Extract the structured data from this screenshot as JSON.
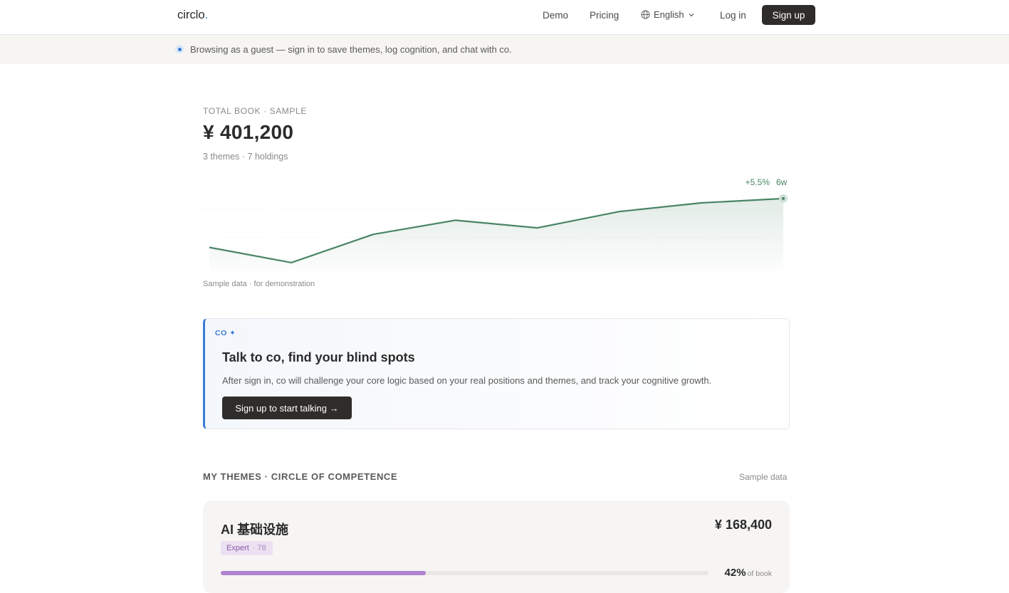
{
  "nav": {
    "logo": "circlo",
    "logo_dot": ".",
    "links": [
      "Demo",
      "Pricing"
    ],
    "language": "English",
    "login": "Log in",
    "signup": "Sign up"
  },
  "banner": {
    "text": "Browsing as a guest — sign in to save themes, log cognition, and chat with co."
  },
  "summary": {
    "label": "TOTAL BOOK · SAMPLE",
    "value": "¥ 401,200",
    "sub": "3 themes · 7 holdings",
    "note": "Sample data · for demonstration"
  },
  "chart_data": {
    "type": "area",
    "values": [
      100.0,
      98.6,
      101.2,
      102.5,
      101.8,
      103.3,
      104.1,
      104.5
    ],
    "ylim": [
      98,
      106
    ],
    "change_label": "+5.5%",
    "end_label": "6w",
    "line_color": "#4a8566",
    "grid": false
  },
  "co_card": {
    "tag": "CO ✦",
    "title": "Talk to co, find your blind spots",
    "description": "After sign in, co will challenge your core logic based on your real positions and themes, and track your cognitive growth.",
    "button": "Sign up to start talking →"
  },
  "themes": {
    "heading": "MY THEMES · CIRCLE OF COMPETENCE",
    "note": "Sample data",
    "items": [
      {
        "name": "AI 基础设施",
        "amount": "¥ 168,400",
        "level": "Expert",
        "score": "· 78",
        "share_pct": 42,
        "share_label": "42%",
        "share_unit": "of book",
        "color": "#b082cf"
      }
    ]
  }
}
